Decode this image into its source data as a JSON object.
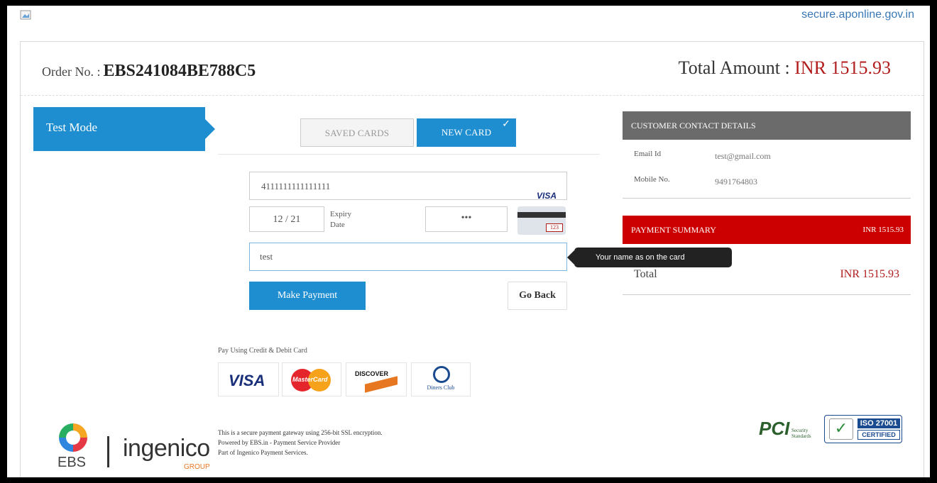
{
  "site": {
    "domain": "secure.aponline.gov.in"
  },
  "order": {
    "label": "Order No. :",
    "number": "EBS241084BE788C5",
    "total_label": "Total Amount :",
    "total_value": "INR 1515.93"
  },
  "mode": {
    "label": "Test Mode"
  },
  "tabs": [
    {
      "label": "SAVED CARDS",
      "active": false
    },
    {
      "label": "NEW CARD",
      "active": true
    }
  ],
  "form": {
    "card_number": "4111111111111111",
    "card_brand": "VISA",
    "expiry_value": "12  /  21",
    "expiry_label_1": "Expiry",
    "expiry_label_2": "Date",
    "cvv_value": "•••",
    "cvv_hint": "123",
    "name_value": "test",
    "name_tooltip": "Your name as on the card",
    "pay_button": "Make Payment",
    "back_button": "Go Back"
  },
  "payment_methods": {
    "title": "Pay Using Credit & Debit Card",
    "visa": "VISA",
    "mastercard": "MasterCard",
    "discover": "DISCOVER",
    "diners": "Diners Club"
  },
  "footer": {
    "ebs": "EBS",
    "ingenico": "ingenico",
    "group": "GROUP",
    "secure_lines": [
      "This is a secure payment gateway using 256-bit SSL encryption.",
      "Powered by EBS.in - Payment Service Provider",
      "Part of Ingenico Payment Services."
    ],
    "pci": "PCI",
    "pci_sub": "Security Standards",
    "iso_top": "ISO 27001",
    "iso_bottom": "CERTIFIED"
  },
  "contact": {
    "title": "CUSTOMER CONTACT DETAILS",
    "email_label": "Email Id",
    "email_value": "test@gmail.com",
    "mobile_label": "Mobile No.",
    "mobile_value": "9491764803"
  },
  "summary": {
    "title": "PAYMENT SUMMARY",
    "amount": "INR 1515.93",
    "total_label": "Total",
    "total_value": "INR 1515.93"
  },
  "colors": {
    "accent": "#1f8ed0",
    "price": "#b11c1c",
    "summary": "#cc0000",
    "contact": "#6b6b6b"
  }
}
